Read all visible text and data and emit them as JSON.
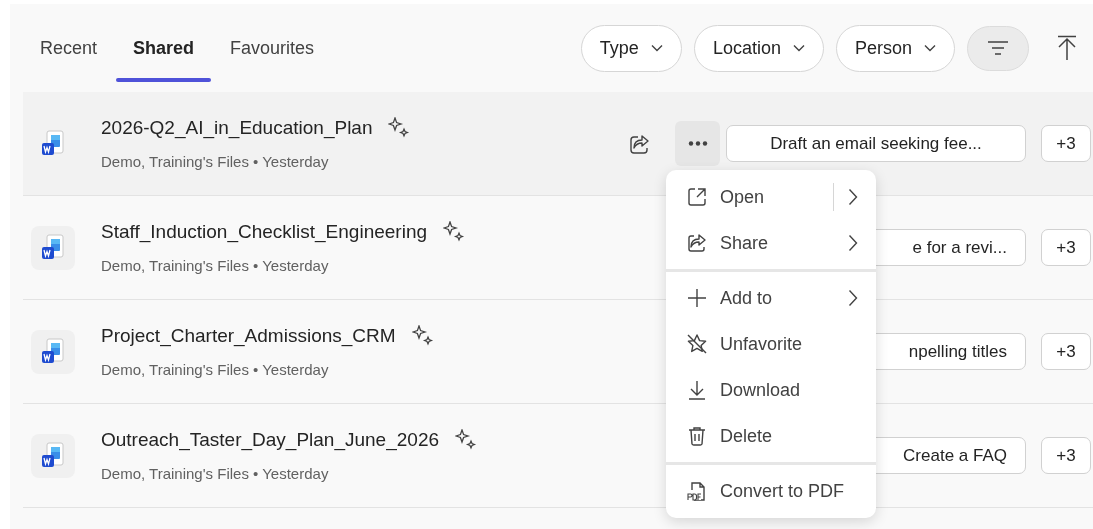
{
  "tabs": [
    {
      "label": "Recent",
      "selected": false
    },
    {
      "label": "Shared",
      "selected": true
    },
    {
      "label": "Favourites",
      "selected": false
    }
  ],
  "filters": [
    "Type",
    "Location",
    "Person"
  ],
  "files": [
    {
      "title": "2026-Q2_AI_in_Education_Plan",
      "meta": "Demo, Training's Files • Yesterday",
      "hovered": true,
      "prompt": "Draft an email seeking fee...",
      "more": "+3"
    },
    {
      "title": "Staff_Induction_Checklist_Engineering",
      "meta": "Demo, Training's Files • Yesterday",
      "hovered": false,
      "prompt": "e for a revi...",
      "more": "+3"
    },
    {
      "title": "Project_Charter_Admissions_CRM",
      "meta": "Demo, Training's Files • Yesterday",
      "hovered": false,
      "prompt": "npelling titles",
      "more": "+3"
    },
    {
      "title": "Outreach_Taster_Day_Plan_June_2026",
      "meta": "Demo, Training's Files • Yesterday",
      "hovered": false,
      "prompt": "Create a FAQ",
      "more": "+3"
    }
  ],
  "context_menu": {
    "groups": [
      [
        {
          "label": "Open",
          "submenu": true,
          "split": true
        },
        {
          "label": "Share",
          "submenu": true,
          "split": false
        }
      ],
      [
        {
          "label": "Add to",
          "submenu": true,
          "split": false
        },
        {
          "label": "Unfavorite",
          "submenu": false,
          "split": false
        },
        {
          "label": "Download",
          "submenu": false,
          "split": false
        },
        {
          "label": "Delete",
          "submenu": false,
          "split": false
        }
      ],
      [
        {
          "label": "Convert to PDF",
          "submenu": false,
          "split": false
        }
      ]
    ]
  }
}
